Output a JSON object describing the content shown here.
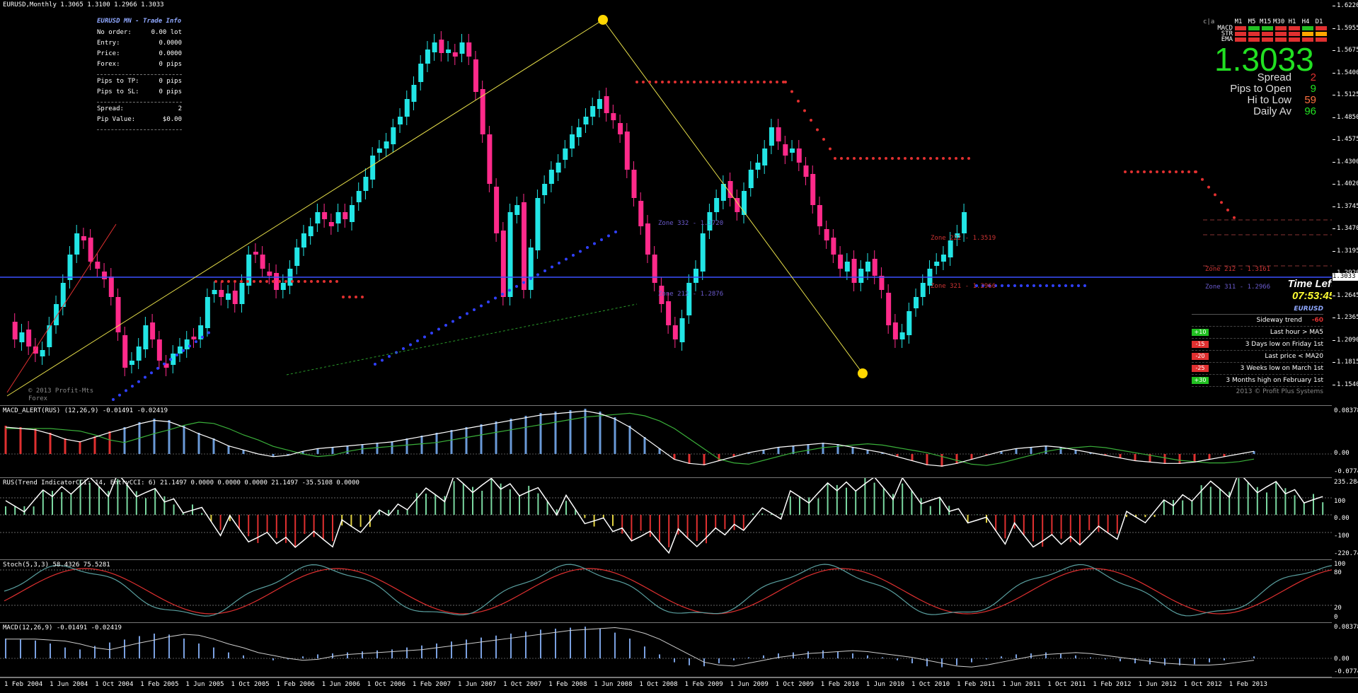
{
  "main": {
    "title": "EURUSD,Monthly  1.3065 1.3100 1.2966 1.3033",
    "price_scale": [
      "1.6220",
      "1.5955",
      "1.5675",
      "1.5400",
      "1.5125",
      "1.4850",
      "1.4575",
      "1.4300",
      "1.4020",
      "1.3745",
      "1.3470",
      "1.3195",
      "1.2920",
      "1.2645",
      "1.2365",
      "1.2090",
      "1.1815",
      "1.1540"
    ],
    "current_price_tag": "1.3033",
    "watermark": [
      "© 2013 Profit-Mts",
      "Forex"
    ],
    "zones": [
      {
        "label": "Zone 332 - 1.3720"
      },
      {
        "label": "Zone 222 - 1.3519"
      },
      {
        "label": "Zone 212 - 1.3161"
      },
      {
        "label": "Zone 321 - 1.2966"
      },
      {
        "label": "Zone 311 - 1.2966"
      },
      {
        "label": "Zone 212 - 1.2876"
      }
    ]
  },
  "trade_info": {
    "heading": "EURUSD MN - Trade Info",
    "rows1": [
      {
        "k": "No order:",
        "v": "0.00 lot"
      },
      {
        "k": "Entry:",
        "v": "0.0000"
      },
      {
        "k": "Price:",
        "v": "0.0000"
      },
      {
        "k": "Forex:",
        "v": "0 pips"
      }
    ],
    "rows2": [
      {
        "k": "Pips to TP:",
        "v": "0 pips"
      },
      {
        "k": "Pips to SL:",
        "v": "0 pips"
      }
    ],
    "rows3": [
      {
        "k": "Spread:",
        "v": "2"
      },
      {
        "k": "Pip Value:",
        "v": "$0.00"
      }
    ]
  },
  "timeframe_panel": {
    "corner": "c|a",
    "columns": [
      "M1",
      "M5",
      "M15",
      "M30",
      "H1",
      "H4",
      "D1"
    ],
    "rows": [
      {
        "name": "MACD",
        "colors": [
          "#e03030",
          "#22c022",
          "#22c022",
          "#e03030",
          "#e03030",
          "#22c022",
          "#e03030"
        ]
      },
      {
        "name": "STR",
        "colors": [
          "#e03030",
          "#e03030",
          "#e03030",
          "#e03030",
          "#e03030",
          "#ffa500",
          "#ffa500"
        ]
      },
      {
        "name": "EMA",
        "colors": [
          "#e03030",
          "#e03030",
          "#e03030",
          "#e03030",
          "#e03030",
          "#e03030",
          "#e03030"
        ]
      }
    ]
  },
  "big_price": "1.3033",
  "stats": [
    {
      "k": "Spread",
      "v": "2",
      "color": "#e03030"
    },
    {
      "k": "Pips to Open",
      "v": "9",
      "color": "#22e022"
    },
    {
      "k": "Hi to Low",
      "v": "59",
      "color": "#ff7040"
    },
    {
      "k": "Daily Av",
      "v": "96",
      "color": "#22e022"
    }
  ],
  "time_left": {
    "label": "Time Left",
    "value": "07:53:45"
  },
  "signals": {
    "symbol": "EURUSD",
    "trend_label": "Sideway trend",
    "trend_value": "-60",
    "items": [
      {
        "badge": "+10",
        "badge_color": "#22c022",
        "text": "Last hour > MA5"
      },
      {
        "badge": "-15",
        "badge_color": "#e03030",
        "text": "3 Days low on Friday 1st"
      },
      {
        "badge": "-20",
        "badge_color": "#e03030",
        "text": "Last price < MA20"
      },
      {
        "badge": "-25",
        "badge_color": "#e03030",
        "text": "3 Weeks low on March 1st"
      },
      {
        "badge": "+30",
        "badge_color": "#22c022",
        "text": "3 Months high on February 1st"
      }
    ],
    "copyright": "2013 © Profit Plus Systems"
  },
  "macd_alert": {
    "title": "MACD_ALERT(RUS) (12,26,9) -0.01491 -0.02419",
    "scale": [
      "0.08378",
      "0.00",
      "-0.07744"
    ]
  },
  "trend": {
    "title": "RUS(Trend IndicatorCCI: 14, EntryCCI: 6)  21.1497 0.0000 0.0000 0.0000 21.1497 -35.5108 0.0000",
    "scale": [
      "235.2843",
      "100",
      "0.00",
      "-100",
      "-220.7427"
    ]
  },
  "stoch": {
    "title": "Stoch(5,3,3) 58.4326 75.5281",
    "scale": [
      "100",
      "80",
      "20",
      "0"
    ]
  },
  "macd": {
    "title": "MACD(12,26,9) -0.01491 -0.02419",
    "scale": [
      "0.08378",
      "0.00",
      "-0.07744"
    ]
  },
  "x_axis": [
    "1 Feb 2004",
    "1 Jun 2004",
    "1 Oct 2004",
    "1 Feb 2005",
    "1 Jun 2005",
    "1 Oct 2005",
    "1 Feb 2006",
    "1 Jun 2006",
    "1 Oct 2006",
    "1 Feb 2007",
    "1 Jun 2007",
    "1 Oct 2007",
    "1 Feb 2008",
    "1 Jun 2008",
    "1 Oct 2008",
    "1 Feb 2009",
    "1 Jun 2009",
    "1 Oct 2009",
    "1 Feb 2010",
    "1 Jun 2010",
    "1 Oct 2010",
    "1 Feb 2011",
    "1 Jun 2011",
    "1 Oct 2011",
    "1 Feb 2012",
    "1 Jun 2012",
    "1 Oct 2012",
    "1 Feb 2013"
  ]
}
